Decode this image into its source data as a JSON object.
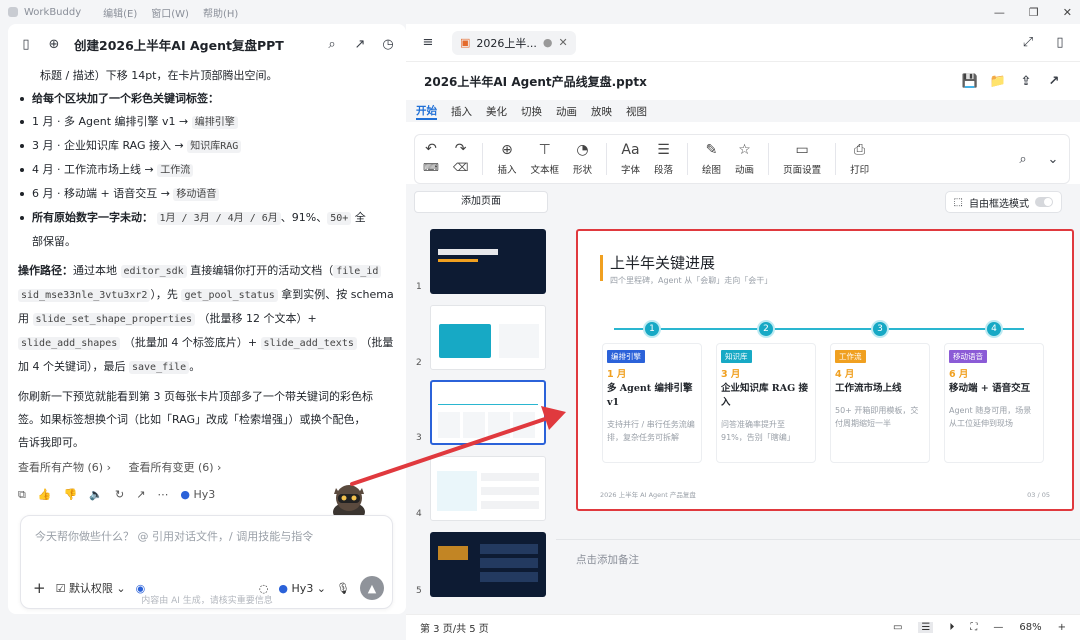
{
  "titlebar": {
    "app": "WorkBuddy",
    "menus": [
      "编辑(E)",
      "窗口(W)",
      "帮助(H)"
    ]
  },
  "left": {
    "title": "创建2026上半年AI Agent复盘PPT",
    "lines": {
      "l0": "标题 / 描述）下移 14pt，在卡片顶部腾出空间。",
      "b1": "给每个区块加了一个彩色关键词标签：",
      "b2a": "1 月 · 多 Agent 编排引擎 v1 →",
      "b2c": "编排引擎",
      "b3a": "3 月 · 企业知识库 RAG 接入 →",
      "b3c": "知识库RAG",
      "b4a": "4 月 · 工作流市场上线 →",
      "b4c": "工作流",
      "b5a": "6 月 · 移动端 + 语音交互 →",
      "b5c": "移动语音",
      "b6a": "所有原始数字一字未动：",
      "b6c": "1月 / 3月 / 4月 / 6月",
      "b6d": "、91%、",
      "b6e": "50+",
      "b6f": "全",
      "b6g": "部保留。",
      "p1a": "操作路径：",
      "p1b": "通过本地",
      "p1c": "editor_sdk",
      "p1d": "直接编辑你打开的活动文档（",
      "p1e": "file_id",
      "p2a": "sid_mse33nle_3vtu3xr2",
      "p2b": "），先",
      "p2c": "get_pool_status",
      "p2d": "拿到实例、按 schema",
      "p3a": "用",
      "p3b": "slide_set_shape_properties",
      "p3c": "（批量移 12 个文本）+",
      "p4a": "slide_add_shapes",
      "p4b": "（批量加 4 个标签底片）+",
      "p4c": "slide_add_texts",
      "p4d": "（批量",
      "p5a": "加 4 个关键词），最后",
      "p5b": "save_file",
      "p5c": "。",
      "q1": "你刷新一下预览就能看到第 3 页每张卡片顶部多了一个带关键词的彩色标",
      "q2": "签。如果标签想换个词（比如「RAG」改成「检索增强」）或换个配色，",
      "q3": "告诉我即可。"
    },
    "links": {
      "a": "查看所有产物 (6)",
      "b": "查看所有变更 (6)"
    },
    "model": "Hy3",
    "input": {
      "placeholder": "今天帮你做些什么？ @ 引用对话文件，/ 调用技能与指令",
      "perm": "默认权限",
      "model": "Hy3"
    },
    "disclaimer": "内容由 AI 生成，请核实重要信息"
  },
  "right": {
    "tab": "2026上半...",
    "doc": "2026上半年AI Agent产品线复盘.pptx",
    "ribbon_tabs": [
      "开始",
      "插入",
      "美化",
      "切换",
      "动画",
      "放映",
      "视图"
    ],
    "ribbon": {
      "insert": "插入",
      "textbox": "文本框",
      "shape": "形状",
      "font": "字体",
      "para": "段落",
      "draw": "绘图",
      "anim": "动画",
      "pagesetup": "页面设置",
      "print": "打印"
    },
    "addpage": "添加页面",
    "freesel": "自由框选模式",
    "thumbs": [
      "1",
      "2",
      "3",
      "4",
      "5"
    ],
    "slide": {
      "title": "上半年关键进展",
      "subtitle": "四个里程碑，Agent 从「会聊」走向「会干」",
      "cards": [
        {
          "n": "1",
          "tag": "编排引擎",
          "color": "#2b62d9",
          "month": "1 月",
          "title": "多 Agent 编排引擎 v1",
          "desc": "支持并行 / 串行任务流编排，复杂任务可拆解"
        },
        {
          "n": "2",
          "tag": "知识库",
          "color": "#17a9c5",
          "month": "3 月",
          "title": "企业知识库 RAG 接入",
          "desc": "问答准确率提升至 91%，告别「瞎编」"
        },
        {
          "n": "3",
          "tag": "工作流",
          "color": "#f0a020",
          "month": "4 月",
          "title": "工作流市场上线",
          "desc": "50+ 开箱即用模板，交付周期缩短一半"
        },
        {
          "n": "4",
          "tag": "移动语音",
          "color": "#8b5bd6",
          "month": "6 月",
          "title": "移动端 + 语音交互",
          "desc": "Agent 随身可用，场景从工位延伸到现场"
        }
      ],
      "footer": "2026 上半年 AI Agent 产品复盘",
      "page": "03 / 05"
    },
    "notes": "点击添加备注",
    "status": {
      "page": "第 3 页/共 5 页",
      "zoom": "68%"
    }
  }
}
